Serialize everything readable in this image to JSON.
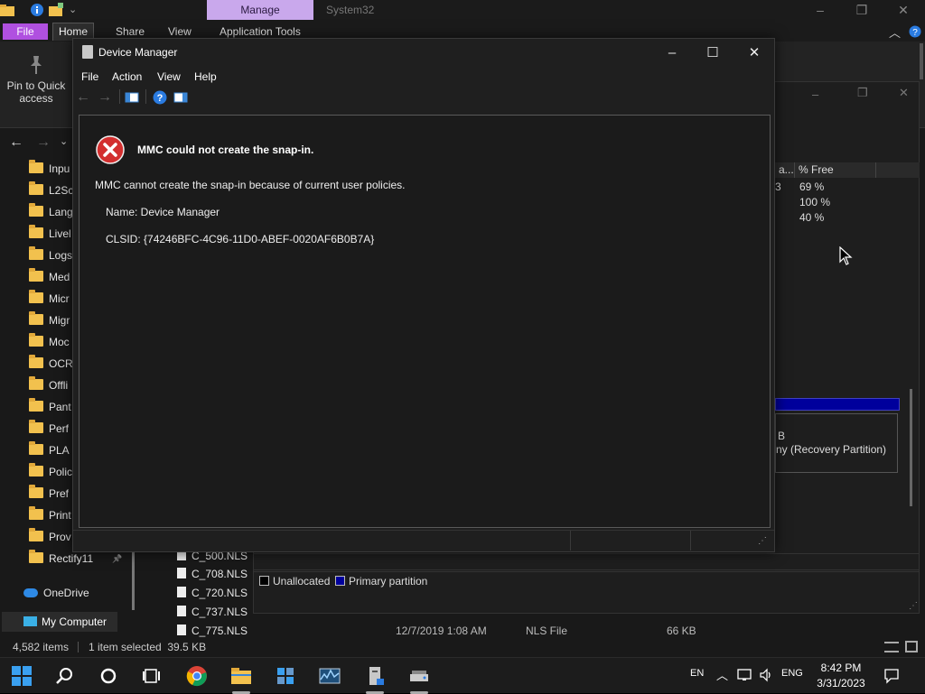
{
  "explorer": {
    "manage_tab": "Manage",
    "window_title": "System32",
    "ribbon_tabs": {
      "file": "File",
      "home": "Home",
      "share": "Share",
      "view": "View",
      "app_tools": "Application Tools"
    },
    "pin_label": "Pin to Quick access",
    "nav_folders": [
      "Inpu",
      "L2Sc",
      "Lang",
      "Livel",
      "Logs",
      "Med",
      "Micr",
      "Migr",
      "Moc",
      "OCR",
      "Offli",
      "Pant",
      "Perf",
      "PLA",
      "Polic",
      "Pref",
      "Print",
      "Prov",
      "Rectify11"
    ],
    "onedrive": "OneDrive",
    "my_computer": "My Computer",
    "files": [
      "C_500.NLS",
      "C_708.NLS",
      "C_720.NLS",
      "C_737.NLS",
      "C_775.NLS"
    ],
    "selected_file": {
      "date": "12/7/2019 1:08 AM",
      "type": "NLS File",
      "size": "66 KB"
    },
    "status": {
      "items": "4,582 items",
      "selected": "1 item selected  39.5 KB"
    }
  },
  "disk_management": {
    "columns": [
      "a...",
      "% Free"
    ],
    "rows": [
      {
        "cap": "3",
        "free": "69 %"
      },
      {
        "cap": "",
        "free": "100 %"
      },
      {
        "cap": "",
        "free": "40 %"
      }
    ],
    "partition_lines": [
      "B",
      "ny (Recovery Partition)"
    ],
    "legend": {
      "unallocated": "Unallocated",
      "primary": "Primary partition"
    },
    "colors": {
      "unallocated": "#000000",
      "primary": "#00009c"
    }
  },
  "device_manager": {
    "title": "Device Manager",
    "menu": [
      "File",
      "Action",
      "View",
      "Help"
    ],
    "error": {
      "title": "MMC could not create the snap-in.",
      "message": "MMC cannot create the snap-in because of current user policies.",
      "name": "Name: Device Manager",
      "clsid": "CLSID: {74246BFC-4C96-11D0-ABEF-0020AF6B0B7A}"
    }
  },
  "taskbar": {
    "lang_short": "EN",
    "lang": "ENG",
    "time": "8:42 PM",
    "date": "3/31/2023",
    "icons": [
      "start-icon",
      "search-icon",
      "cortana-icon",
      "task-view-icon",
      "chrome-icon",
      "file-explorer-icon",
      "app-icon",
      "resource-monitor-icon",
      "device-manager-icon",
      "disk-management-icon"
    ]
  },
  "colors": {
    "accent_purple": "#b050e0",
    "manage_tab": "#c9a8ec",
    "error_red": "#d32f2f"
  }
}
